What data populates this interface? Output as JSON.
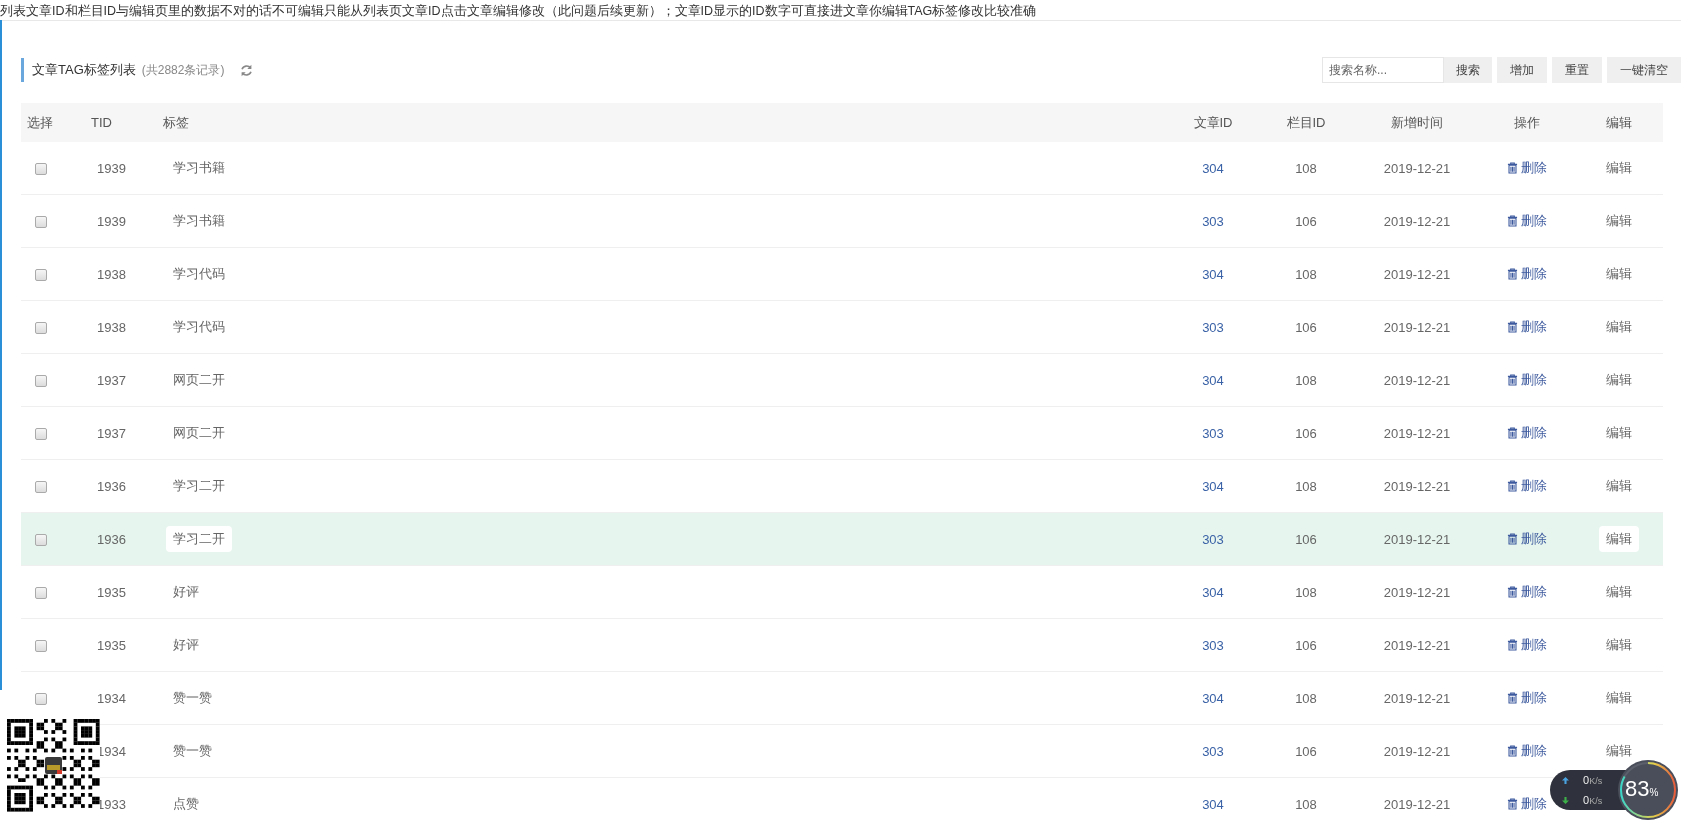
{
  "notice": "列表文章ID和栏目ID与编辑页里的数据不对的话不可编辑只能从列表页文章ID点击文章编辑修改（此问题后续更新）；文章ID显示的ID数字可直接进文章你编辑TAG标签修改比较准确",
  "title": "文章TAG标签列表",
  "record_count": "(共2882条记录)",
  "search": {
    "placeholder": "搜索名称..."
  },
  "buttons": [
    "搜索",
    "增加",
    "重置",
    "一键清空"
  ],
  "columns": [
    "选择",
    "TID",
    "标签",
    "文章ID",
    "栏目ID",
    "新增时间",
    "操作",
    "编辑"
  ],
  "rows": [
    {
      "checked": false,
      "tid": "1939",
      "tag": "学习书籍",
      "article_id": "304",
      "column_id": "108",
      "date": "2019-12-21",
      "action": "删除",
      "edit": "编辑",
      "highlighted": false
    },
    {
      "checked": false,
      "tid": "1939",
      "tag": "学习书籍",
      "article_id": "303",
      "column_id": "106",
      "date": "2019-12-21",
      "action": "删除",
      "edit": "编辑",
      "highlighted": false
    },
    {
      "checked": false,
      "tid": "1938",
      "tag": "学习代码",
      "article_id": "304",
      "column_id": "108",
      "date": "2019-12-21",
      "action": "删除",
      "edit": "编辑",
      "highlighted": false
    },
    {
      "checked": false,
      "tid": "1938",
      "tag": "学习代码",
      "article_id": "303",
      "column_id": "106",
      "date": "2019-12-21",
      "action": "删除",
      "edit": "编辑",
      "highlighted": false
    },
    {
      "checked": false,
      "tid": "1937",
      "tag": "网页二开",
      "article_id": "304",
      "column_id": "108",
      "date": "2019-12-21",
      "action": "删除",
      "edit": "编辑",
      "highlighted": false
    },
    {
      "checked": false,
      "tid": "1937",
      "tag": "网页二开",
      "article_id": "303",
      "column_id": "106",
      "date": "2019-12-21",
      "action": "删除",
      "edit": "编辑",
      "highlighted": false
    },
    {
      "checked": false,
      "tid": "1936",
      "tag": "学习二开",
      "article_id": "304",
      "column_id": "108",
      "date": "2019-12-21",
      "action": "删除",
      "edit": "编辑",
      "highlighted": false
    },
    {
      "checked": false,
      "tid": "1936",
      "tag": "学习二开",
      "article_id": "303",
      "column_id": "106",
      "date": "2019-12-21",
      "action": "删除",
      "edit": "编辑",
      "highlighted": true
    },
    {
      "checked": false,
      "tid": "1935",
      "tag": "好评",
      "article_id": "304",
      "column_id": "108",
      "date": "2019-12-21",
      "action": "删除",
      "edit": "编辑",
      "highlighted": false
    },
    {
      "checked": false,
      "tid": "1935",
      "tag": "好评",
      "article_id": "303",
      "column_id": "106",
      "date": "2019-12-21",
      "action": "删除",
      "edit": "编辑",
      "highlighted": false
    },
    {
      "checked": false,
      "tid": "1934",
      "tag": "赞一赞",
      "article_id": "304",
      "column_id": "108",
      "date": "2019-12-21",
      "action": "删除",
      "edit": "编辑",
      "highlighted": false
    },
    {
      "tid": "1934",
      "tag": "赞一赞",
      "article_id": "303",
      "column_id": "106",
      "date": "2019-12-21",
      "action": "删除",
      "edit": "编辑",
      "highlighted": false
    },
    {
      "tid": "1933",
      "tag": "点赞",
      "article_id": "304",
      "column_id": "108",
      "date": "2019-12-21",
      "action": "删除",
      "highlighted": false
    }
  ],
  "speed_widget": {
    "upload": {
      "value": "0",
      "unit": "K/s"
    },
    "download": {
      "value": "0",
      "unit": "K/s"
    },
    "percent": "83",
    "percent_unit": "%"
  }
}
